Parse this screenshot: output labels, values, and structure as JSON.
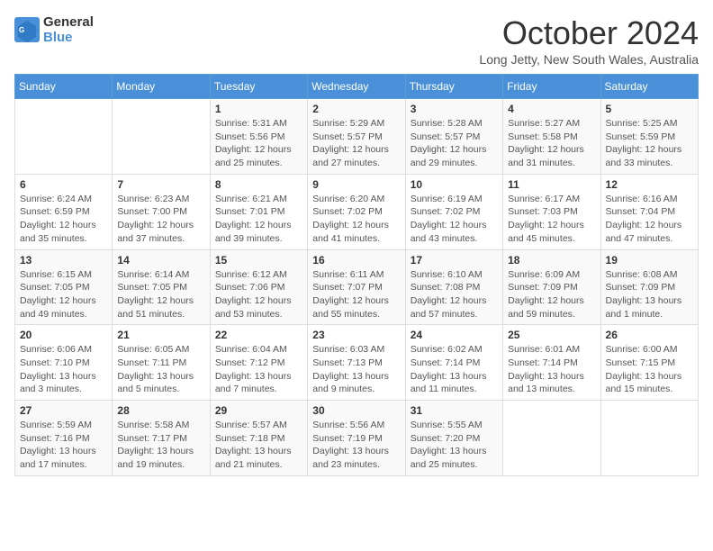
{
  "header": {
    "logo_line1": "General",
    "logo_line2": "Blue",
    "month": "October 2024",
    "location": "Long Jetty, New South Wales, Australia"
  },
  "days_of_week": [
    "Sunday",
    "Monday",
    "Tuesday",
    "Wednesday",
    "Thursday",
    "Friday",
    "Saturday"
  ],
  "weeks": [
    [
      {
        "day": "",
        "info": ""
      },
      {
        "day": "",
        "info": ""
      },
      {
        "day": "1",
        "info": "Sunrise: 5:31 AM\nSunset: 5:56 PM\nDaylight: 12 hours\nand 25 minutes."
      },
      {
        "day": "2",
        "info": "Sunrise: 5:29 AM\nSunset: 5:57 PM\nDaylight: 12 hours\nand 27 minutes."
      },
      {
        "day": "3",
        "info": "Sunrise: 5:28 AM\nSunset: 5:57 PM\nDaylight: 12 hours\nand 29 minutes."
      },
      {
        "day": "4",
        "info": "Sunrise: 5:27 AM\nSunset: 5:58 PM\nDaylight: 12 hours\nand 31 minutes."
      },
      {
        "day": "5",
        "info": "Sunrise: 5:25 AM\nSunset: 5:59 PM\nDaylight: 12 hours\nand 33 minutes."
      }
    ],
    [
      {
        "day": "6",
        "info": "Sunrise: 6:24 AM\nSunset: 6:59 PM\nDaylight: 12 hours\nand 35 minutes."
      },
      {
        "day": "7",
        "info": "Sunrise: 6:23 AM\nSunset: 7:00 PM\nDaylight: 12 hours\nand 37 minutes."
      },
      {
        "day": "8",
        "info": "Sunrise: 6:21 AM\nSunset: 7:01 PM\nDaylight: 12 hours\nand 39 minutes."
      },
      {
        "day": "9",
        "info": "Sunrise: 6:20 AM\nSunset: 7:02 PM\nDaylight: 12 hours\nand 41 minutes."
      },
      {
        "day": "10",
        "info": "Sunrise: 6:19 AM\nSunset: 7:02 PM\nDaylight: 12 hours\nand 43 minutes."
      },
      {
        "day": "11",
        "info": "Sunrise: 6:17 AM\nSunset: 7:03 PM\nDaylight: 12 hours\nand 45 minutes."
      },
      {
        "day": "12",
        "info": "Sunrise: 6:16 AM\nSunset: 7:04 PM\nDaylight: 12 hours\nand 47 minutes."
      }
    ],
    [
      {
        "day": "13",
        "info": "Sunrise: 6:15 AM\nSunset: 7:05 PM\nDaylight: 12 hours\nand 49 minutes."
      },
      {
        "day": "14",
        "info": "Sunrise: 6:14 AM\nSunset: 7:05 PM\nDaylight: 12 hours\nand 51 minutes."
      },
      {
        "day": "15",
        "info": "Sunrise: 6:12 AM\nSunset: 7:06 PM\nDaylight: 12 hours\nand 53 minutes."
      },
      {
        "day": "16",
        "info": "Sunrise: 6:11 AM\nSunset: 7:07 PM\nDaylight: 12 hours\nand 55 minutes."
      },
      {
        "day": "17",
        "info": "Sunrise: 6:10 AM\nSunset: 7:08 PM\nDaylight: 12 hours\nand 57 minutes."
      },
      {
        "day": "18",
        "info": "Sunrise: 6:09 AM\nSunset: 7:09 PM\nDaylight: 12 hours\nand 59 minutes."
      },
      {
        "day": "19",
        "info": "Sunrise: 6:08 AM\nSunset: 7:09 PM\nDaylight: 13 hours\nand 1 minute."
      }
    ],
    [
      {
        "day": "20",
        "info": "Sunrise: 6:06 AM\nSunset: 7:10 PM\nDaylight: 13 hours\nand 3 minutes."
      },
      {
        "day": "21",
        "info": "Sunrise: 6:05 AM\nSunset: 7:11 PM\nDaylight: 13 hours\nand 5 minutes."
      },
      {
        "day": "22",
        "info": "Sunrise: 6:04 AM\nSunset: 7:12 PM\nDaylight: 13 hours\nand 7 minutes."
      },
      {
        "day": "23",
        "info": "Sunrise: 6:03 AM\nSunset: 7:13 PM\nDaylight: 13 hours\nand 9 minutes."
      },
      {
        "day": "24",
        "info": "Sunrise: 6:02 AM\nSunset: 7:14 PM\nDaylight: 13 hours\nand 11 minutes."
      },
      {
        "day": "25",
        "info": "Sunrise: 6:01 AM\nSunset: 7:14 PM\nDaylight: 13 hours\nand 13 minutes."
      },
      {
        "day": "26",
        "info": "Sunrise: 6:00 AM\nSunset: 7:15 PM\nDaylight: 13 hours\nand 15 minutes."
      }
    ],
    [
      {
        "day": "27",
        "info": "Sunrise: 5:59 AM\nSunset: 7:16 PM\nDaylight: 13 hours\nand 17 minutes."
      },
      {
        "day": "28",
        "info": "Sunrise: 5:58 AM\nSunset: 7:17 PM\nDaylight: 13 hours\nand 19 minutes."
      },
      {
        "day": "29",
        "info": "Sunrise: 5:57 AM\nSunset: 7:18 PM\nDaylight: 13 hours\nand 21 minutes."
      },
      {
        "day": "30",
        "info": "Sunrise: 5:56 AM\nSunset: 7:19 PM\nDaylight: 13 hours\nand 23 minutes."
      },
      {
        "day": "31",
        "info": "Sunrise: 5:55 AM\nSunset: 7:20 PM\nDaylight: 13 hours\nand 25 minutes."
      },
      {
        "day": "",
        "info": ""
      },
      {
        "day": "",
        "info": ""
      }
    ]
  ]
}
